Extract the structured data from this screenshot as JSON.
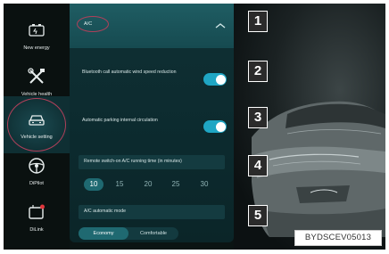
{
  "sidebar": {
    "items": [
      {
        "label": "New energy",
        "icon": "battery-icon"
      },
      {
        "label": "Vehicle health",
        "icon": "wrench-screwdriver-icon"
      },
      {
        "label": "Vehicle setting",
        "icon": "car-icon",
        "active": true
      },
      {
        "label": "DiPilot",
        "icon": "steering-wheel-icon"
      },
      {
        "label": "DiLink",
        "icon": "dilink-icon"
      }
    ]
  },
  "panel": {
    "section_title": "A/C",
    "rows": {
      "wind_speed_label": "Bluetooth call automatic wind speed reduction",
      "wind_speed_on": true,
      "parking_label": "Automatic parking internal circulation",
      "parking_on": true,
      "remote_label": "Remote switch-on A/C running time (in minutes)",
      "remote_options": [
        "10",
        "15",
        "20",
        "25",
        "30"
      ],
      "remote_selected": "10",
      "mode_label": "A/C automatic mode",
      "mode_options": [
        "Economy",
        "Comfortable"
      ],
      "mode_selected": "Economy"
    }
  },
  "callouts": [
    "1",
    "2",
    "3",
    "4",
    "5"
  ],
  "reference_code": "BYDSCEV05013",
  "colors": {
    "accent": "#1fa6c4",
    "panel_bg": "#0f3034",
    "highlight_ring": "#b0405a"
  }
}
